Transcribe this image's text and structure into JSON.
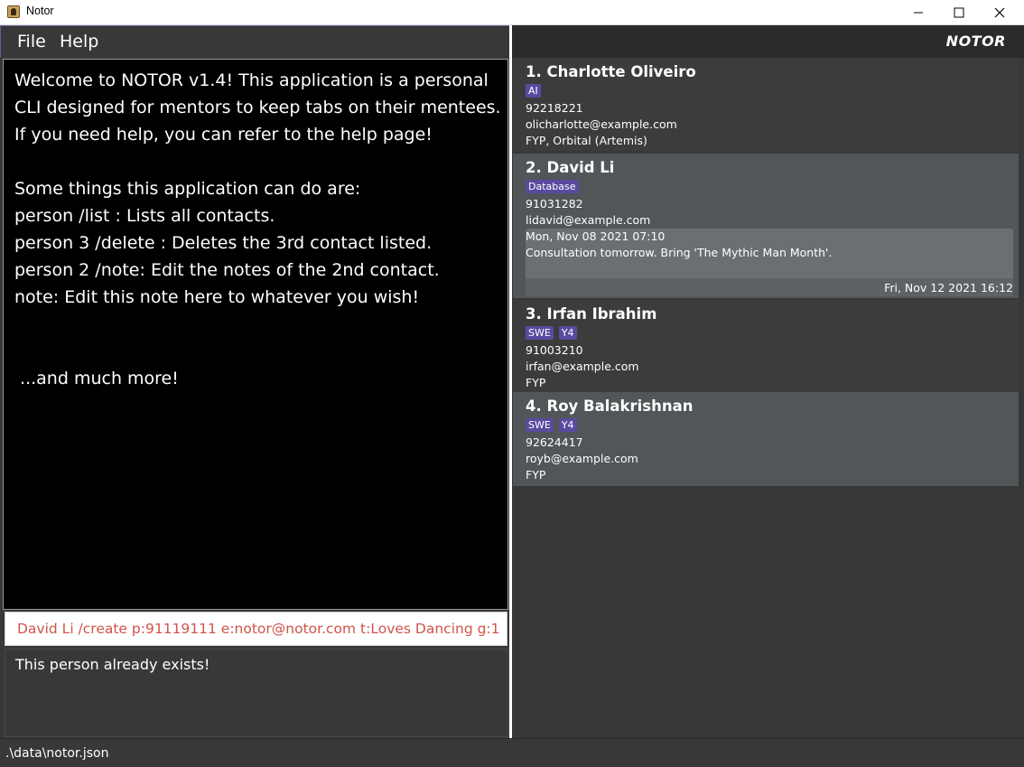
{
  "window": {
    "title": "Notor",
    "icons": [
      "app-icon",
      "minimize-icon",
      "maximize-icon",
      "close-icon"
    ]
  },
  "menu": {
    "file_label": "File",
    "help_label": "Help"
  },
  "brand": {
    "logo_text": "NOTOR"
  },
  "welcome": {
    "lines": [
      "Welcome to NOTOR v1.4! This application is a personal",
      "CLI designed for mentors to keep tabs on their mentees.",
      "If you need help, you can refer to the help page!",
      "Some things this application can do are:",
      "person /list : Lists all contacts.",
      "person 3 /delete : Deletes the 3rd contact listed.",
      "person 2 /note: Edit the notes of the 2nd contact.",
      "note: Edit this note here to whatever you wish!",
      " ...and much more!"
    ]
  },
  "command": {
    "value": "David Li /create p:91119111 e:notor@notor.com t:Loves Dancing g:1"
  },
  "result": {
    "message": "This person already exists!"
  },
  "contacts": [
    {
      "name": "1.  Charlotte Oliveiro",
      "tags": [
        "AI"
      ],
      "phone": "92218221",
      "email": "olicharlotte@example.com",
      "groups": "FYP, Orbital (Artemis)"
    },
    {
      "name": "2.  David Li",
      "tags": [
        "Database"
      ],
      "phone": "91031282",
      "email": "lidavid@example.com",
      "note": {
        "date": "Mon, Nov 08 2021 07:10",
        "text": "Consultation tomorrow. Bring 'The Mythic Man Month'.",
        "edited": "Fri, Nov 12 2021 16:12"
      }
    },
    {
      "name": "3.  Irfan Ibrahim",
      "tags": [
        "SWE",
        "Y4"
      ],
      "phone": "91003210",
      "email": "irfan@example.com",
      "groups": "FYP"
    },
    {
      "name": "4.  Roy Balakrishnan",
      "tags": [
        "SWE",
        "Y4"
      ],
      "phone": "92624417",
      "email": "royb@example.com",
      "groups": "FYP"
    }
  ],
  "status": {
    "save_path": ".\\data\\notor.json"
  },
  "colors": {
    "background": "#383838",
    "tag": "#5a4aa0",
    "command_text": "#d0544a"
  }
}
